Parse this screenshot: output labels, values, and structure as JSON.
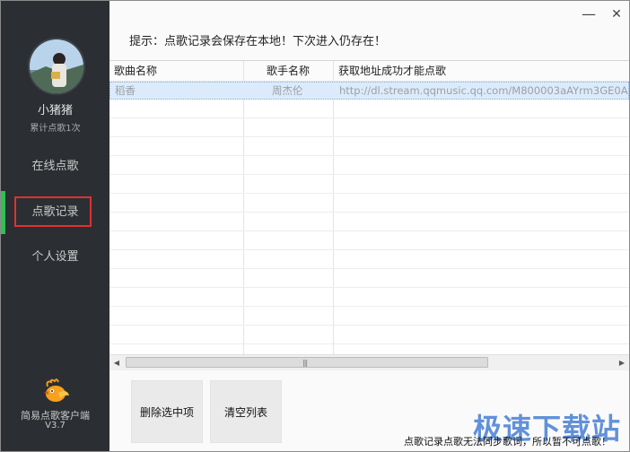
{
  "sidebar": {
    "username": "小猪猪",
    "count_text": "累计点歌1次",
    "nav": [
      {
        "label": "在线点歌"
      },
      {
        "label": "点歌记录"
      },
      {
        "label": "个人设置"
      }
    ],
    "active_color": "#2fbf55",
    "app_name": "简易点歌客户端",
    "version": "V3.7"
  },
  "window": {
    "minimize_icon": "minimize-icon",
    "close_icon": "close-icon"
  },
  "main": {
    "hint": "提示：点歌记录会保存在本地！下次进入仍存在！",
    "table": {
      "columns": [
        "歌曲名称",
        "歌手名称",
        "获取地址成功才能点歌"
      ],
      "rows": [
        {
          "song": "稻香",
          "singer": "周杰伦",
          "url": "http://dl.stream.qqmusic.qq.com/M800003aAYrm3GE0A"
        }
      ]
    },
    "buttons": {
      "delete": "删除选中项",
      "clear": "清空列表"
    },
    "footer_note": "点歌记录点歌无法同步歌词，所以暂不可点歌！"
  },
  "watermark": "极速下载站"
}
